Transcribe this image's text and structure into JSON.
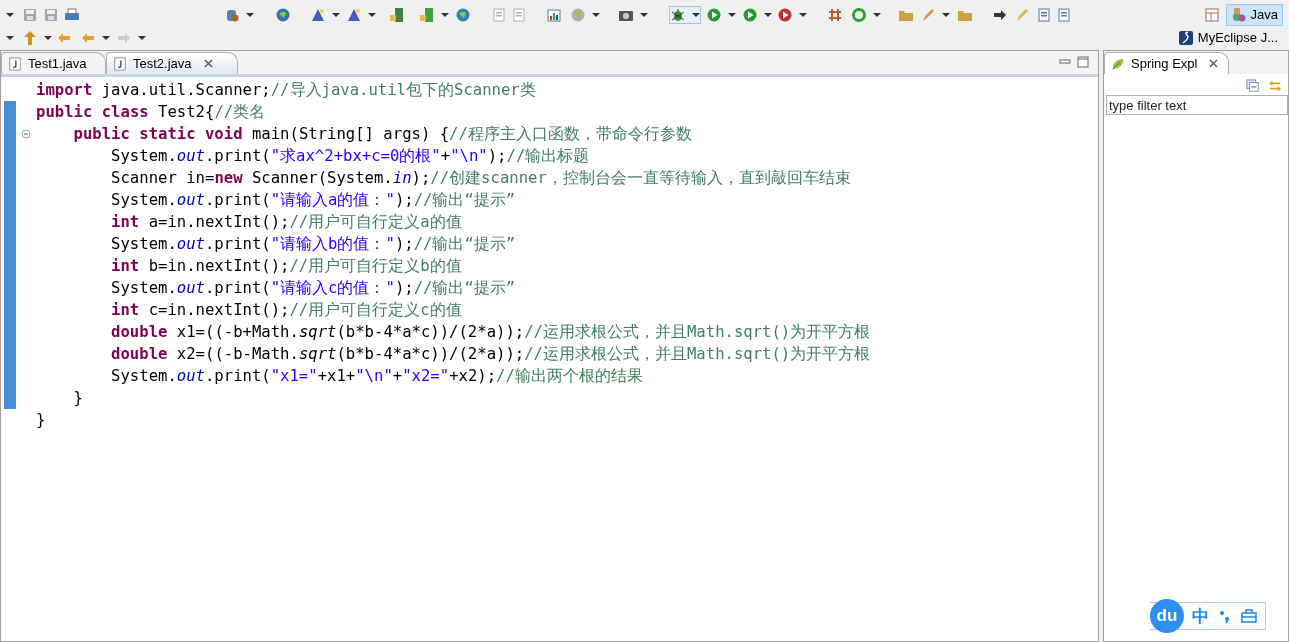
{
  "perspectives": [
    {
      "label": "Java",
      "selected": true
    },
    {
      "label": "MyEclipse J...",
      "selected": false
    }
  ],
  "editor": {
    "tabs": [
      {
        "label": "Test1.java",
        "selected": false
      },
      {
        "label": "Test2.java",
        "selected": true
      }
    ],
    "lines": [
      {
        "foldable": false,
        "marked": false,
        "tokens": [
          {
            "kind": "keyword",
            "text": "import"
          },
          {
            "kind": "plain",
            "text": " java.util.Scanner;"
          },
          {
            "kind": "comment",
            "text": "//导入java.util包下的Scanner类"
          }
        ]
      },
      {
        "foldable": false,
        "marked": true,
        "tokens": [
          {
            "kind": "keyword",
            "text": "public class"
          },
          {
            "kind": "plain",
            "text": " Test2{"
          },
          {
            "kind": "comment",
            "text": "//类名"
          }
        ],
        "children": [
          {
            "foldable": true,
            "marked": true,
            "tokens": [
              {
                "kind": "keyword",
                "text": "public static void"
              },
              {
                "kind": "plain",
                "text": " main(String[] args) {"
              },
              {
                "kind": "comment",
                "text": "//程序主入口函数，带命令行参数"
              }
            ],
            "children": [
              {
                "foldable": false,
                "marked": true,
                "tokens": [
                  {
                    "kind": "plain",
                    "text": "System."
                  },
                  {
                    "kind": "field",
                    "text": "out"
                  },
                  {
                    "kind": "plain",
                    "text": ".print("
                  },
                  {
                    "kind": "string",
                    "text": "\"求ax^2+bx+c=0的根\""
                  },
                  {
                    "kind": "plain",
                    "text": "+"
                  },
                  {
                    "kind": "string",
                    "text": "\"\\n\""
                  },
                  {
                    "kind": "plain",
                    "text": ");"
                  },
                  {
                    "kind": "comment",
                    "text": "//输出标题"
                  }
                ]
              },
              {
                "foldable": false,
                "marked": true,
                "tokens": [
                  {
                    "kind": "plain",
                    "text": "Scanner in="
                  },
                  {
                    "kind": "keyword",
                    "text": "new"
                  },
                  {
                    "kind": "plain",
                    "text": " Scanner(System."
                  },
                  {
                    "kind": "field",
                    "text": "in"
                  },
                  {
                    "kind": "plain",
                    "text": ");"
                  },
                  {
                    "kind": "comment",
                    "text": "//创建scanner，控制台会一直等待输入，直到敲回车结束"
                  }
                ]
              },
              {
                "foldable": false,
                "marked": true,
                "tokens": [
                  {
                    "kind": "plain",
                    "text": "System."
                  },
                  {
                    "kind": "field",
                    "text": "out"
                  },
                  {
                    "kind": "plain",
                    "text": ".print("
                  },
                  {
                    "kind": "string",
                    "text": "\"请输入a的值：\""
                  },
                  {
                    "kind": "plain",
                    "text": ");"
                  },
                  {
                    "kind": "comment",
                    "text": "//输出“提示”"
                  }
                ]
              },
              {
                "foldable": false,
                "marked": true,
                "tokens": [
                  {
                    "kind": "keyword",
                    "text": "int"
                  },
                  {
                    "kind": "plain",
                    "text": " a=in.nextInt();"
                  },
                  {
                    "kind": "comment",
                    "text": "//用户可自行定义a的值"
                  }
                ]
              },
              {
                "foldable": false,
                "marked": true,
                "tokens": [
                  {
                    "kind": "plain",
                    "text": "System."
                  },
                  {
                    "kind": "field",
                    "text": "out"
                  },
                  {
                    "kind": "plain",
                    "text": ".print("
                  },
                  {
                    "kind": "string",
                    "text": "\"请输入b的值：\""
                  },
                  {
                    "kind": "plain",
                    "text": ");"
                  },
                  {
                    "kind": "comment",
                    "text": "//输出“提示”"
                  }
                ]
              },
              {
                "foldable": false,
                "marked": true,
                "tokens": [
                  {
                    "kind": "keyword",
                    "text": "int"
                  },
                  {
                    "kind": "plain",
                    "text": " b=in.nextInt();"
                  },
                  {
                    "kind": "comment",
                    "text": "//用户可自行定义b的值"
                  }
                ]
              },
              {
                "foldable": false,
                "marked": true,
                "tokens": [
                  {
                    "kind": "plain",
                    "text": "System."
                  },
                  {
                    "kind": "field",
                    "text": "out"
                  },
                  {
                    "kind": "plain",
                    "text": ".print("
                  },
                  {
                    "kind": "string",
                    "text": "\"请输入c的值：\""
                  },
                  {
                    "kind": "plain",
                    "text": ");"
                  },
                  {
                    "kind": "comment",
                    "text": "//输出“提示”"
                  }
                ]
              },
              {
                "foldable": false,
                "marked": true,
                "tokens": [
                  {
                    "kind": "keyword",
                    "text": "int"
                  },
                  {
                    "kind": "plain",
                    "text": " c=in.nextInt();"
                  },
                  {
                    "kind": "comment",
                    "text": "//用户可自行定义c的值"
                  }
                ]
              },
              {
                "foldable": false,
                "marked": true,
                "tokens": [
                  {
                    "kind": "keyword",
                    "text": "double"
                  },
                  {
                    "kind": "plain",
                    "text": " x1=((-b+Math."
                  },
                  {
                    "kind": "method",
                    "text": "sqrt"
                  },
                  {
                    "kind": "plain",
                    "text": "(b*b-4*a*c))/(2*a));"
                  },
                  {
                    "kind": "comment",
                    "text": "//运用求根公式，并且Math.sqrt()为开平方根"
                  }
                ]
              },
              {
                "foldable": false,
                "marked": true,
                "tokens": [
                  {
                    "kind": "keyword",
                    "text": "double"
                  },
                  {
                    "kind": "plain",
                    "text": " x2=((-b-Math."
                  },
                  {
                    "kind": "method",
                    "text": "sqrt"
                  },
                  {
                    "kind": "plain",
                    "text": "(b*b-4*a*c))/(2*a));"
                  },
                  {
                    "kind": "comment",
                    "text": "//运用求根公式，并且Math.sqrt()为开平方根"
                  }
                ]
              },
              {
                "foldable": false,
                "marked": true,
                "tokens": [
                  {
                    "kind": "plain",
                    "text": "System."
                  },
                  {
                    "kind": "field",
                    "text": "out"
                  },
                  {
                    "kind": "plain",
                    "text": ".print("
                  },
                  {
                    "kind": "string",
                    "text": "\"x1=\""
                  },
                  {
                    "kind": "plain",
                    "text": "+x1+"
                  },
                  {
                    "kind": "string",
                    "text": "\"\\n\""
                  },
                  {
                    "kind": "plain",
                    "text": "+"
                  },
                  {
                    "kind": "string",
                    "text": "\"x2=\""
                  },
                  {
                    "kind": "plain",
                    "text": "+x2);"
                  },
                  {
                    "kind": "comment",
                    "text": "//输出两个根的结果"
                  }
                ]
              }
            ]
          },
          {
            "foldable": false,
            "marked": true,
            "tokens": [
              {
                "kind": "plain",
                "text": "}"
              }
            ]
          }
        ]
      },
      {
        "foldable": false,
        "marked": false,
        "tokens": [
          {
            "kind": "plain",
            "text": "}"
          }
        ]
      }
    ]
  },
  "side_view": {
    "tab": {
      "label": "Spring Expl",
      "selected": true
    },
    "filter": {
      "placeholder": "type filter text"
    }
  },
  "ime_toolbar": {
    "logo": "du",
    "mode": "中"
  }
}
